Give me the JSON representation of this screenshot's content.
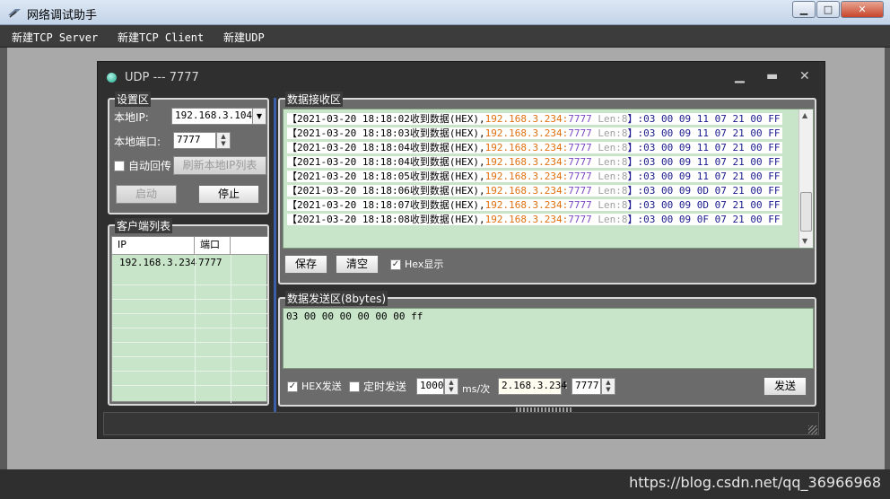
{
  "window": {
    "title": "网络调试助手"
  },
  "menu": {
    "items": [
      "新建TCP Server",
      "新建TCP Client",
      "新建UDP"
    ]
  },
  "udp_window": {
    "title": "UDP --- 7777"
  },
  "settings": {
    "group_label": "设置区",
    "local_ip_label": "本地IP:",
    "local_ip_value": "192.168.3.104",
    "local_port_label": "本地端口:",
    "local_port_value": "7777",
    "auto_reply_label": "自动回传",
    "refresh_button": "刷新本地IP列表",
    "start_button": "启动",
    "stop_button": "停止"
  },
  "clients": {
    "group_label": "客户端列表",
    "columns": [
      "IP",
      "端口"
    ],
    "rows": [
      {
        "ip": "192.168.3.234",
        "port": "7777"
      }
    ]
  },
  "receive": {
    "group_label": "数据接收区",
    "lines": [
      {
        "ts": "【2021-03-20 18:18:02收到数据(HEX),",
        "ip": "192.168.3.234:",
        "port": "7777",
        "len": " Len:8",
        "data": "】:03 00 09 11 07 21 00 FF"
      },
      {
        "ts": "【2021-03-20 18:18:03收到数据(HEX),",
        "ip": "192.168.3.234:",
        "port": "7777",
        "len": " Len:8",
        "data": "】:03 00 09 11 07 21 00 FF"
      },
      {
        "ts": "【2021-03-20 18:18:04收到数据(HEX),",
        "ip": "192.168.3.234:",
        "port": "7777",
        "len": " Len:8",
        "data": "】:03 00 09 11 07 21 00 FF"
      },
      {
        "ts": "【2021-03-20 18:18:04收到数据(HEX),",
        "ip": "192.168.3.234:",
        "port": "7777",
        "len": " Len:8",
        "data": "】:03 00 09 11 07 21 00 FF"
      },
      {
        "ts": "【2021-03-20 18:18:05收到数据(HEX),",
        "ip": "192.168.3.234:",
        "port": "7777",
        "len": " Len:8",
        "data": "】:03 00 09 11 07 21 00 FF"
      },
      {
        "ts": "【2021-03-20 18:18:06收到数据(HEX),",
        "ip": "192.168.3.234:",
        "port": "7777",
        "len": " Len:8",
        "data": "】:03 00 09 0D 07 21 00 FF"
      },
      {
        "ts": "【2021-03-20 18:18:07收到数据(HEX),",
        "ip": "192.168.3.234:",
        "port": "7777",
        "len": " Len:8",
        "data": "】:03 00 09 0D 07 21 00 FF"
      },
      {
        "ts": "【2021-03-20 18:18:08收到数据(HEX),",
        "ip": "192.168.3.234:",
        "port": "7777",
        "len": " Len:8",
        "data": "】:03 00 09 0F 07 21 00 FF"
      }
    ],
    "save_button": "保存",
    "clear_button": "清空",
    "hex_display_label": "Hex显示"
  },
  "send": {
    "group_label": "数据发送区(8bytes)",
    "content": "03 00 00 00 00 00 00 ff",
    "hex_send_label": "HEX发送",
    "timed_send_label": "定时发送",
    "interval_value": "1000",
    "interval_unit": "ms/次",
    "target_ip_value": "2.168.3.234",
    "ip_port_sep": ":",
    "target_port_value": "7777",
    "send_button": "发送"
  },
  "watermark": "https://blog.csdn.net/qq_36966968",
  "colors": {
    "recv_bg": "#c9e5c9",
    "ip_color": "#e07010",
    "data_color": "#1a1a8c"
  }
}
